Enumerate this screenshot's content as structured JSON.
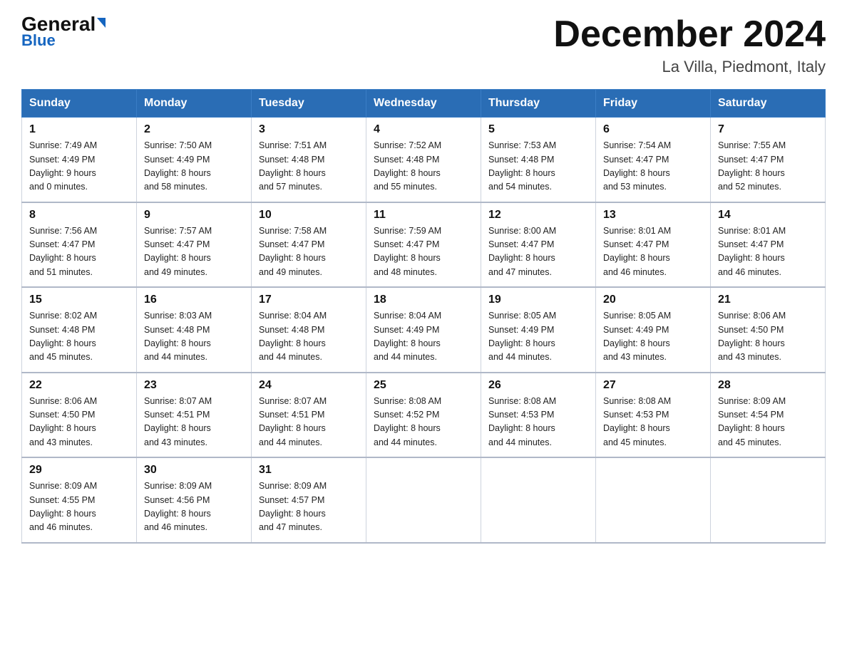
{
  "header": {
    "logo_general": "General",
    "logo_blue": "Blue",
    "title": "December 2024",
    "subtitle": "La Villa, Piedmont, Italy"
  },
  "days_of_week": [
    "Sunday",
    "Monday",
    "Tuesday",
    "Wednesday",
    "Thursday",
    "Friday",
    "Saturday"
  ],
  "weeks": [
    [
      {
        "day": "1",
        "sunrise": "7:49 AM",
        "sunset": "4:49 PM",
        "daylight": "9 hours and 0 minutes."
      },
      {
        "day": "2",
        "sunrise": "7:50 AM",
        "sunset": "4:49 PM",
        "daylight": "8 hours and 58 minutes."
      },
      {
        "day": "3",
        "sunrise": "7:51 AM",
        "sunset": "4:48 PM",
        "daylight": "8 hours and 57 minutes."
      },
      {
        "day": "4",
        "sunrise": "7:52 AM",
        "sunset": "4:48 PM",
        "daylight": "8 hours and 55 minutes."
      },
      {
        "day": "5",
        "sunrise": "7:53 AM",
        "sunset": "4:48 PM",
        "daylight": "8 hours and 54 minutes."
      },
      {
        "day": "6",
        "sunrise": "7:54 AM",
        "sunset": "4:47 PM",
        "daylight": "8 hours and 53 minutes."
      },
      {
        "day": "7",
        "sunrise": "7:55 AM",
        "sunset": "4:47 PM",
        "daylight": "8 hours and 52 minutes."
      }
    ],
    [
      {
        "day": "8",
        "sunrise": "7:56 AM",
        "sunset": "4:47 PM",
        "daylight": "8 hours and 51 minutes."
      },
      {
        "day": "9",
        "sunrise": "7:57 AM",
        "sunset": "4:47 PM",
        "daylight": "8 hours and 49 minutes."
      },
      {
        "day": "10",
        "sunrise": "7:58 AM",
        "sunset": "4:47 PM",
        "daylight": "8 hours and 49 minutes."
      },
      {
        "day": "11",
        "sunrise": "7:59 AM",
        "sunset": "4:47 PM",
        "daylight": "8 hours and 48 minutes."
      },
      {
        "day": "12",
        "sunrise": "8:00 AM",
        "sunset": "4:47 PM",
        "daylight": "8 hours and 47 minutes."
      },
      {
        "day": "13",
        "sunrise": "8:01 AM",
        "sunset": "4:47 PM",
        "daylight": "8 hours and 46 minutes."
      },
      {
        "day": "14",
        "sunrise": "8:01 AM",
        "sunset": "4:47 PM",
        "daylight": "8 hours and 46 minutes."
      }
    ],
    [
      {
        "day": "15",
        "sunrise": "8:02 AM",
        "sunset": "4:48 PM",
        "daylight": "8 hours and 45 minutes."
      },
      {
        "day": "16",
        "sunrise": "8:03 AM",
        "sunset": "4:48 PM",
        "daylight": "8 hours and 44 minutes."
      },
      {
        "day": "17",
        "sunrise": "8:04 AM",
        "sunset": "4:48 PM",
        "daylight": "8 hours and 44 minutes."
      },
      {
        "day": "18",
        "sunrise": "8:04 AM",
        "sunset": "4:49 PM",
        "daylight": "8 hours and 44 minutes."
      },
      {
        "day": "19",
        "sunrise": "8:05 AM",
        "sunset": "4:49 PM",
        "daylight": "8 hours and 44 minutes."
      },
      {
        "day": "20",
        "sunrise": "8:05 AM",
        "sunset": "4:49 PM",
        "daylight": "8 hours and 43 minutes."
      },
      {
        "day": "21",
        "sunrise": "8:06 AM",
        "sunset": "4:50 PM",
        "daylight": "8 hours and 43 minutes."
      }
    ],
    [
      {
        "day": "22",
        "sunrise": "8:06 AM",
        "sunset": "4:50 PM",
        "daylight": "8 hours and 43 minutes."
      },
      {
        "day": "23",
        "sunrise": "8:07 AM",
        "sunset": "4:51 PM",
        "daylight": "8 hours and 43 minutes."
      },
      {
        "day": "24",
        "sunrise": "8:07 AM",
        "sunset": "4:51 PM",
        "daylight": "8 hours and 44 minutes."
      },
      {
        "day": "25",
        "sunrise": "8:08 AM",
        "sunset": "4:52 PM",
        "daylight": "8 hours and 44 minutes."
      },
      {
        "day": "26",
        "sunrise": "8:08 AM",
        "sunset": "4:53 PM",
        "daylight": "8 hours and 44 minutes."
      },
      {
        "day": "27",
        "sunrise": "8:08 AM",
        "sunset": "4:53 PM",
        "daylight": "8 hours and 45 minutes."
      },
      {
        "day": "28",
        "sunrise": "8:09 AM",
        "sunset": "4:54 PM",
        "daylight": "8 hours and 45 minutes."
      }
    ],
    [
      {
        "day": "29",
        "sunrise": "8:09 AM",
        "sunset": "4:55 PM",
        "daylight": "8 hours and 46 minutes."
      },
      {
        "day": "30",
        "sunrise": "8:09 AM",
        "sunset": "4:56 PM",
        "daylight": "8 hours and 46 minutes."
      },
      {
        "day": "31",
        "sunrise": "8:09 AM",
        "sunset": "4:57 PM",
        "daylight": "8 hours and 47 minutes."
      },
      null,
      null,
      null,
      null
    ]
  ]
}
